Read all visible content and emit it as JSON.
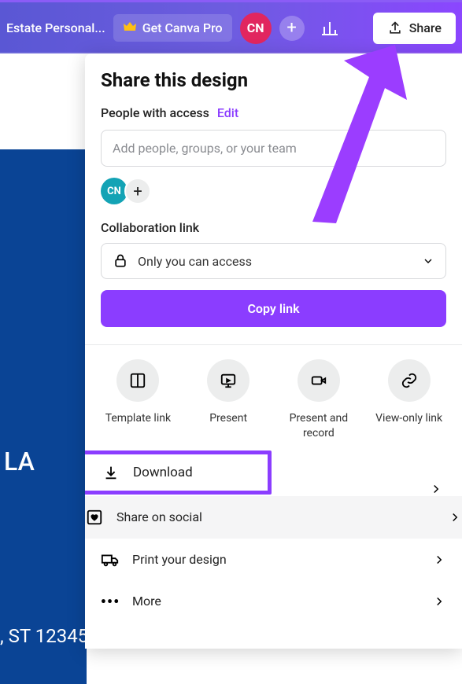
{
  "header": {
    "doc_title": "Estate Personal...",
    "pro_label": "Get Canva Pro",
    "avatar_initials": "CN",
    "share_label": "Share"
  },
  "canvas": {
    "la": "LA",
    "addr": ", ST 12345"
  },
  "panel": {
    "title": "Share this design",
    "access_label": "People with access",
    "edit_label": "Edit",
    "add_people_placeholder": "Add people, groups, or your team",
    "avatar_small": "CN",
    "collab_label": "Collaboration link",
    "collab_value": "Only you can access",
    "copy_label": "Copy link",
    "actions": [
      {
        "label": "Template link"
      },
      {
        "label": "Present"
      },
      {
        "label": "Present and record"
      },
      {
        "label": "View-only link"
      }
    ],
    "options": {
      "download": "Download",
      "share_social": "Share on social",
      "print": "Print your design",
      "more": "More"
    }
  }
}
